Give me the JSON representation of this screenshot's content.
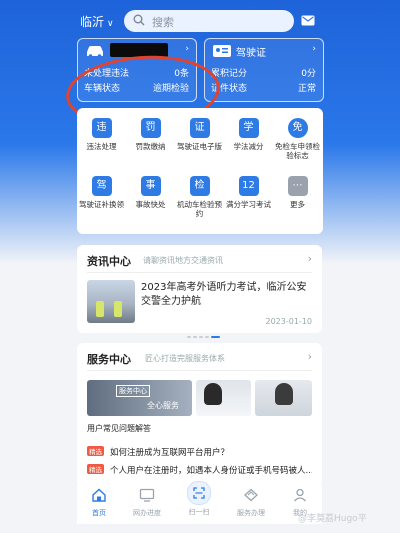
{
  "header": {
    "city": "临沂",
    "search_placeholder": "搜索",
    "icons": {
      "search": "search-icon",
      "mail": "mail-icon",
      "city_chevron": "chevron-down-icon"
    }
  },
  "vehicle_card": {
    "arrow": "›",
    "rows": [
      {
        "label": "未处理违法",
        "value": "0条"
      },
      {
        "label": "车辆状态",
        "value": "逾期检验"
      }
    ]
  },
  "license_card": {
    "title": "驾驶证",
    "arrow": "›",
    "rows": [
      {
        "label": "累积记分",
        "value": "0分"
      },
      {
        "label": "证件状态",
        "value": "正常"
      }
    ]
  },
  "services": [
    {
      "label": "违法处理",
      "icon": "违"
    },
    {
      "label": "罚款缴纳",
      "icon": "罚"
    },
    {
      "label": "驾驶证电子版",
      "icon": "证"
    },
    {
      "label": "学法减分",
      "icon": "学"
    },
    {
      "label": "免检车申领检验标志",
      "icon": "免"
    },
    {
      "label": "驾驶证补换领",
      "icon": "驾"
    },
    {
      "label": "事故快处",
      "icon": "事"
    },
    {
      "label": "机动车检验预约",
      "icon": "检"
    },
    {
      "label": "满分学习考试",
      "icon": "12"
    },
    {
      "label": "更多",
      "icon": "⋯"
    }
  ],
  "news": {
    "title": "资讯中心",
    "subtitle": "请聊资讯地方交通资讯",
    "arrow": "›",
    "headline": "2023年高考外语听力考试，临沂公安交警全力护航",
    "date": "2023-01-10"
  },
  "service_center": {
    "title": "服务中心",
    "subtitle": "匠心打造完服服务体系",
    "arrow": "›",
    "banner_tag": "服务中心",
    "banner_text": "全心服务",
    "faq_title": "用户常见问题解答",
    "questions": [
      {
        "badge": "精选",
        "text": "如何注册成为互联网平台用户？"
      },
      {
        "badge": "精选",
        "text": "个人用户在注册时，如遇本人身份证或手机号码被人..."
      }
    ]
  },
  "tabbar": [
    {
      "label": "首页",
      "icon": "home-icon",
      "active": true
    },
    {
      "label": "网办进度",
      "icon": "monitor-icon",
      "active": false
    },
    {
      "label": "扫一扫",
      "icon": "scan-icon",
      "active": false
    },
    {
      "label": "服务办理",
      "icon": "diamond-icon",
      "active": false
    },
    {
      "label": "我的",
      "icon": "user-icon",
      "active": false
    }
  ],
  "watermark": "@李莫荔Hugo平"
}
